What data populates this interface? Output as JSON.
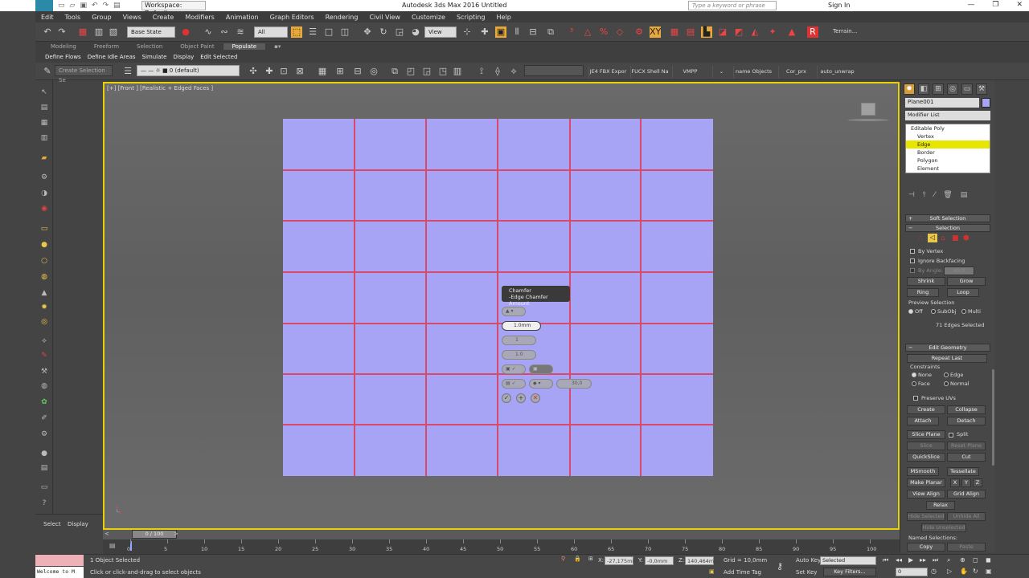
{
  "titlebar": {
    "workspace": "Workspace: Default",
    "app_title": "Autodesk 3ds Max 2016   Untitled",
    "search_placeholder": "Type a keyword or phrase",
    "signin": "Sign In",
    "winbtns": [
      "—",
      "❐",
      "✕"
    ]
  },
  "menu": [
    "Edit",
    "Tools",
    "Group",
    "Views",
    "Create",
    "Modifiers",
    "Animation",
    "Graph Editors",
    "Rendering",
    "Civil View",
    "Customize",
    "Scripting",
    "Help"
  ],
  "toolbar1": {
    "base_state": "Base State",
    "filter": "All",
    "ref_coord": "View",
    "terrain": "Terrain..."
  },
  "ribbon": {
    "tabs": [
      "Modeling",
      "Freeform",
      "Selection",
      "Object Paint",
      "Populate"
    ],
    "active_tab": "Populate",
    "subtabs": [
      "Define Flows",
      "Define Idle Areas",
      "Simulate",
      "Display",
      "Edit Selected"
    ]
  },
  "toolbar2": {
    "selection_set": "Create Selection Se",
    "layer": "0 (default)",
    "plugins": [
      "JE4 FBX Expor",
      "FUCX Shell Na",
      "VMPP",
      "name Objects",
      "Cor_prx",
      "auto_unwrap"
    ]
  },
  "left_panel": {
    "select": "Select",
    "display": "Display"
  },
  "viewport": {
    "label": "[+] [Front ] [Realistic + Edged Faces ]",
    "axis_x": "x",
    "axis_z": "z"
  },
  "caddy": {
    "title": "Chamfer",
    "subtitle": "-Edge Chamfer Amount",
    "amount": "1.0mm",
    "segments": "1",
    "tension": "1.0",
    "angle": "30,0"
  },
  "command_panel": {
    "object_name": "Plane001",
    "modifier_list": "Modifier List",
    "stack": [
      "Editable Poly",
      "Vertex",
      "Edge",
      "Border",
      "Polygon",
      "Element"
    ],
    "stack_selected": "Edge",
    "soft_selection": "Soft Selection",
    "selection": "Selection",
    "by_vertex": "By Vertex",
    "ignore_backfacing": "Ignore Backfacing",
    "by_angle": "By Angle:",
    "by_angle_value": "45,0",
    "shrink": "Shrink",
    "grow": "Grow",
    "ring": "Ring",
    "loop": "Loop",
    "preview_selection": "Preview Selection",
    "preview_opts": [
      "Off",
      "SubObj",
      "Multi"
    ],
    "edges_selected": "71 Edges Selected",
    "edit_geometry": "Edit Geometry",
    "repeat_last": "Repeat Last",
    "constraints": "Constraints",
    "constraint_opts": [
      "None",
      "Edge",
      "Face",
      "Normal"
    ],
    "preserve_uvs": "Preserve UVs",
    "create": "Create",
    "collapse": "Collapse",
    "attach": "Attach",
    "detach": "Detach",
    "slice_plane": "Slice Plane",
    "split": "Split",
    "slice": "Slice",
    "reset_plane": "Reset Plane",
    "quickslice": "QuickSlice",
    "cut": "Cut",
    "msmooth": "MSmooth",
    "tessellate": "Tessellate",
    "make_planar": "Make Planar",
    "xyz": [
      "X",
      "Y",
      "Z"
    ],
    "view_align": "View Align",
    "grid_align": "Grid Align",
    "relax": "Relax",
    "hide_selected": "Hide Selected",
    "unhide_all": "Unhide All",
    "hide_unselected": "Hide Unselected",
    "named_selections": "Named Selections:",
    "copy": "Copy",
    "paste": "Paste"
  },
  "timeline": {
    "frame": "0 / 100",
    "ticks": [
      "0",
      "5",
      "10",
      "15",
      "20",
      "25",
      "30",
      "35",
      "40",
      "45",
      "50",
      "55",
      "60",
      "65",
      "70",
      "75",
      "80",
      "85",
      "90",
      "95",
      "100"
    ]
  },
  "status": {
    "maxscript": "Welcome to M",
    "selected": "1 Object Selected",
    "prompt": "Click or click-and-drag to select objects",
    "x_label": "X:",
    "x": "-27,175mm",
    "y_label": "Y:",
    "y": "-0,0mm",
    "z_label": "Z:",
    "z": "140,464mm",
    "grid": "Grid = 10,0mm",
    "add_time_tag": "Add Time Tag",
    "auto_key": "Auto Key",
    "set_key": "Set Key",
    "selected_drop": "Selected",
    "key_filters": "Key Filters...",
    "frame_input": "0"
  }
}
